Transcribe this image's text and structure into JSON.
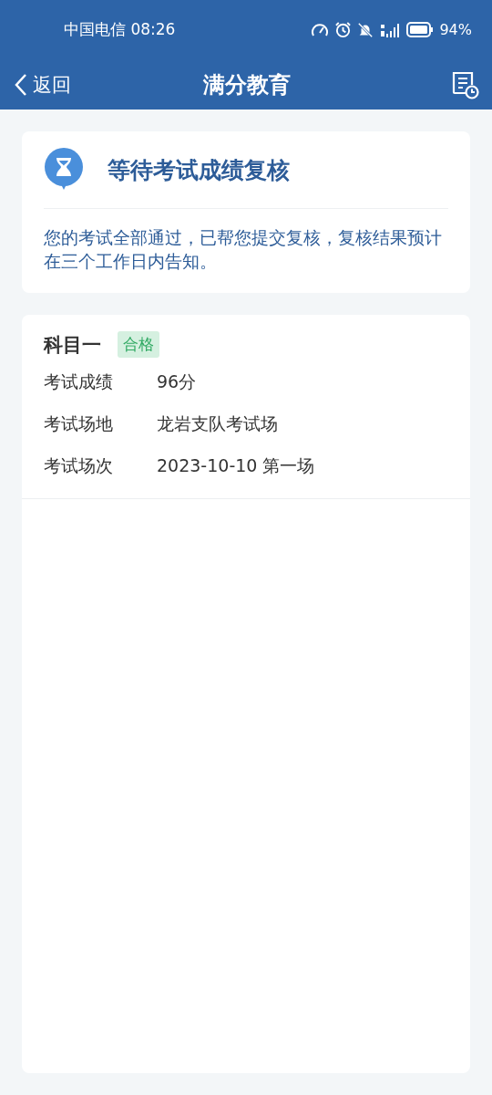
{
  "status_bar": {
    "carrier_time": "中国电信 08:26",
    "battery": "94%"
  },
  "nav": {
    "back": "返回",
    "title": "满分教育"
  },
  "notice": {
    "title": "等待考试成绩复核",
    "message": "您的考试全部通过，已帮您提交复核，复核结果预计在三个工作日内告知。"
  },
  "subject": {
    "title": "科目一",
    "badge": "合格",
    "rows": [
      {
        "label": "考试成绩",
        "value": "96分"
      },
      {
        "label": "考试场地",
        "value": "龙岩支队考试场"
      },
      {
        "label": "考试场次",
        "value": "2023-10-10 第一场"
      }
    ]
  }
}
